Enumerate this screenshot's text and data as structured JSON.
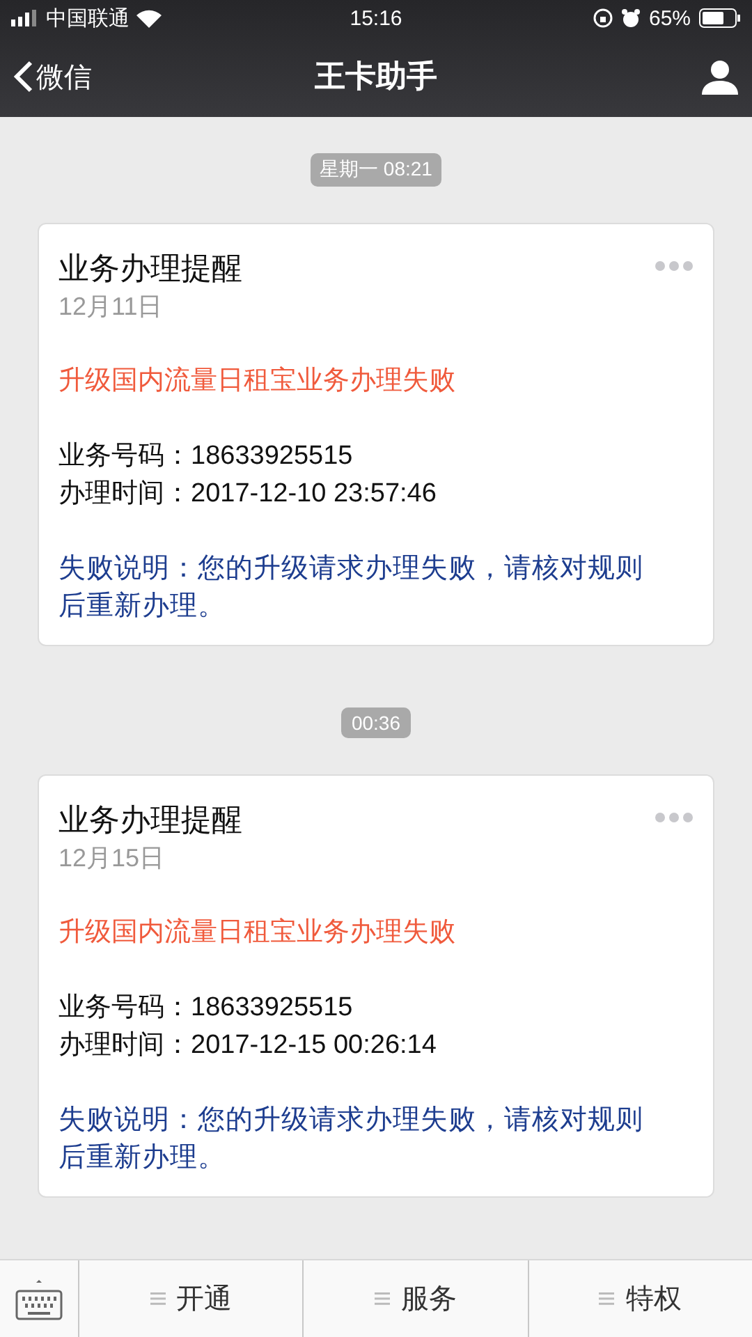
{
  "status_bar": {
    "carrier": "中国联通",
    "time": "15:16",
    "battery": "65%"
  },
  "nav": {
    "back": "微信",
    "title": "王卡助手"
  },
  "messages": [
    {
      "timestamp": "星期一 08:21",
      "title": "业务办理提醒",
      "date": "12月11日",
      "alert": "升级国内流量日租宝业务办理失败",
      "details": [
        "业务号码：18633925515",
        "办理时间：2017-12-10 23:57:46"
      ],
      "note": "失败说明：您的升级请求办理失败，请核对规则后重新办理。"
    },
    {
      "timestamp": "00:36",
      "title": "业务办理提醒",
      "date": "12月15日",
      "alert": "升级国内流量日租宝业务办理失败",
      "details": [
        "业务号码：18633925515",
        "办理时间：2017-12-15 00:26:14"
      ],
      "note": "失败说明：您的升级请求办理失败，请核对规则后重新办理。"
    }
  ],
  "menu": [
    "开通",
    "服务",
    "特权"
  ]
}
